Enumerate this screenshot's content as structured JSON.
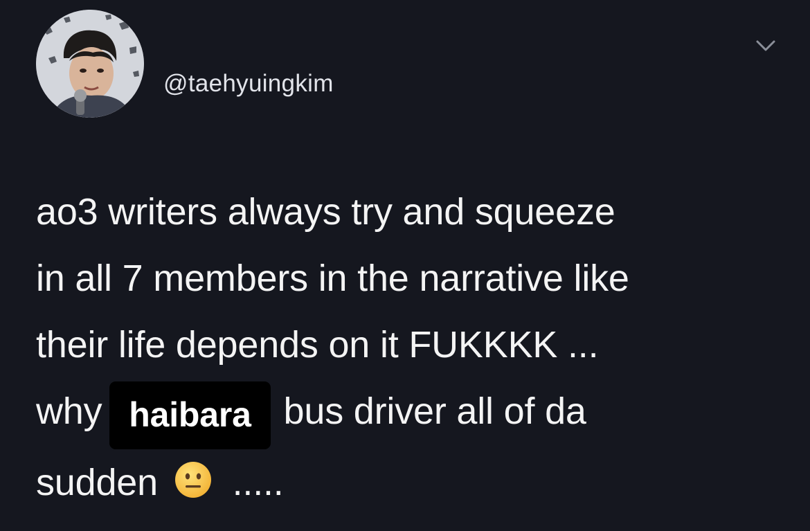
{
  "tweet": {
    "handle": "@taehyuingkim",
    "lines": [
      "ao3 writers always try and squeeze",
      "in all 7 members in the narrative like",
      "their life depends on it FUKKKK ..."
    ],
    "line4_before": "why",
    "line4_highlight": "haibara",
    "line4_after": "bus driver all of da",
    "line5_before": "sudden",
    "line5_emoji": "neutral-face-emoji",
    "line5_after": "....."
  },
  "icons": {
    "menu": "chevron-down-icon",
    "emoji": "neutral-face-emoji"
  },
  "colors": {
    "background": "#15171f",
    "text": "#f4f4f4",
    "handle": "#e2e4ea",
    "highlight_bg": "#000000",
    "chevron": "#8b8f99"
  }
}
